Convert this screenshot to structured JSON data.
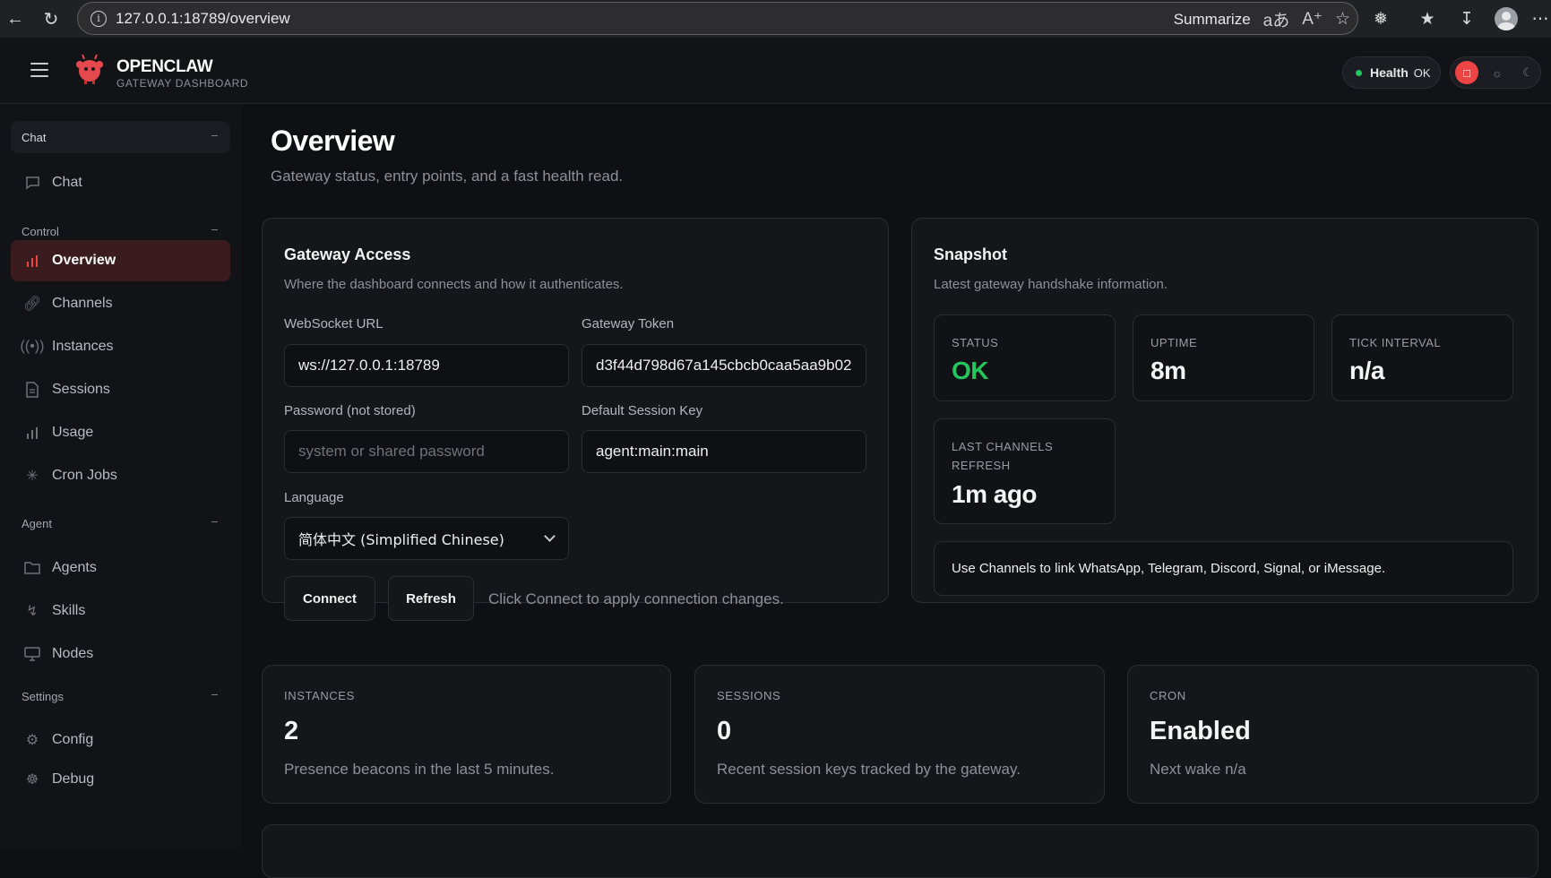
{
  "browser": {
    "url": "127.0.0.1:18789/overview",
    "summarize_label": "Summarize"
  },
  "header": {
    "brand_title": "OPENCLAW",
    "brand_subtitle": "GATEWAY DASHBOARD",
    "health_label": "Health",
    "health_status": "OK",
    "health_color": "#22c55e",
    "accent_color": "#ef4444"
  },
  "sidebar": {
    "sections": [
      {
        "title": "Chat",
        "items": [
          {
            "label": "Chat",
            "icon": "message-icon"
          }
        ]
      },
      {
        "title": "Control",
        "items": [
          {
            "label": "Overview",
            "icon": "bar-chart-icon",
            "active": true
          },
          {
            "label": "Channels",
            "icon": "link-icon"
          },
          {
            "label": "Instances",
            "icon": "broadcast-icon"
          },
          {
            "label": "Sessions",
            "icon": "document-icon"
          },
          {
            "label": "Usage",
            "icon": "bar-chart-icon"
          },
          {
            "label": "Cron Jobs",
            "icon": "loader-icon"
          }
        ]
      },
      {
        "title": "Agent",
        "items": [
          {
            "label": "Agents",
            "icon": "folder-icon"
          },
          {
            "label": "Skills",
            "icon": "bolt-icon"
          },
          {
            "label": "Nodes",
            "icon": "monitor-icon"
          }
        ]
      },
      {
        "title": "Settings",
        "items": [
          {
            "label": "Config",
            "icon": "gear-icon"
          },
          {
            "label": "Debug",
            "icon": "bug-icon"
          }
        ]
      }
    ]
  },
  "page": {
    "title": "Overview",
    "subtitle": "Gateway status, entry points, and a fast health read."
  },
  "gateway_access": {
    "title": "Gateway Access",
    "subtitle": "Where the dashboard connects and how it authenticates.",
    "websocket_label": "WebSocket URL",
    "websocket_value": "ws://127.0.0.1:18789",
    "token_label": "Gateway Token",
    "token_value": "d3f44d798d67a145cbcb0caa5aa9b02",
    "password_label": "Password (not stored)",
    "password_placeholder": "system or shared password",
    "session_key_label": "Default Session Key",
    "session_key_value": "agent:main:main",
    "language_label": "Language",
    "language_value": "简体中文 (Simplified Chinese)",
    "connect_label": "Connect",
    "refresh_label": "Refresh",
    "hint": "Click Connect to apply connection changes."
  },
  "snapshot": {
    "title": "Snapshot",
    "subtitle": "Latest gateway handshake information.",
    "status_label": "STATUS",
    "status_value": "OK",
    "uptime_label": "UPTIME",
    "uptime_value": "8m",
    "tick_label": "TICK INTERVAL",
    "tick_value": "n/a",
    "refresh_label_line1": "LAST CHANNELS",
    "refresh_label_line2": "REFRESH",
    "refresh_value": "1m ago",
    "note": "Use Channels to link WhatsApp, Telegram, Discord, Signal, or iMessage."
  },
  "metrics": [
    {
      "label": "INSTANCES",
      "value": "2",
      "sub": "Presence beacons in the last 5 minutes."
    },
    {
      "label": "SESSIONS",
      "value": "0",
      "sub": "Recent session keys tracked by the gateway."
    },
    {
      "label": "CRON",
      "value": "Enabled",
      "sub": "Next wake n/a"
    }
  ]
}
